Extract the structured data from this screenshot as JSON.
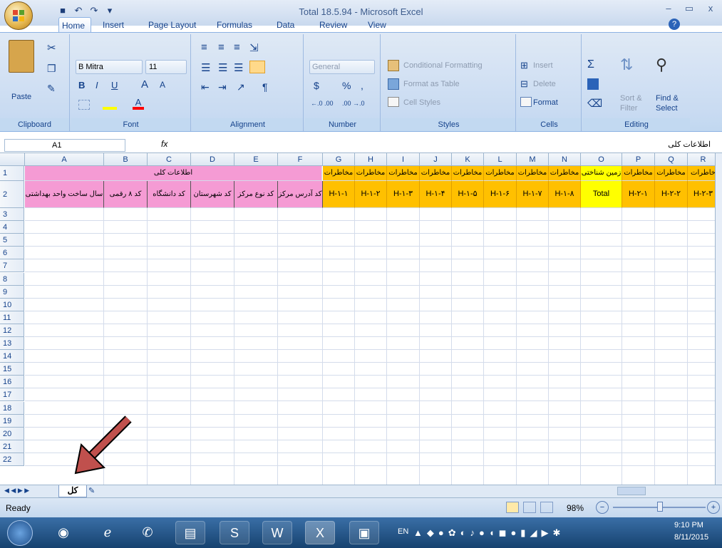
{
  "window": {
    "title": "Total 18.5.94 - Microsoft Excel",
    "min": "–",
    "restore": "▭",
    "close": "x"
  },
  "tabs": [
    {
      "label": "Home"
    },
    {
      "label": "Insert"
    },
    {
      "label": "Page Layout"
    },
    {
      "label": "Formulas"
    },
    {
      "label": "Data"
    },
    {
      "label": "Review"
    },
    {
      "label": "View"
    }
  ],
  "ribbon": {
    "clipboard": {
      "label": "Clipboard",
      "paste": "Paste"
    },
    "font": {
      "label": "Font",
      "name": "B Mitra",
      "size": "11",
      "bold": "B",
      "italic": "I",
      "underline": "U",
      "grow": "A",
      "shrink": "A"
    },
    "alignment": {
      "label": "Alignment"
    },
    "number": {
      "label": "Number",
      "format": "General",
      "currency": "$",
      "percent": "%",
      "comma": ",",
      "inc": "←.0 .00",
      "dec": ".00 →.0"
    },
    "styles": {
      "label": "Styles",
      "conditional": "Conditional Formatting",
      "table": "Format as Table",
      "cell": "Cell Styles"
    },
    "cells": {
      "label": "Cells",
      "insert": "Insert",
      "delete": "Delete",
      "format": "Format"
    },
    "editing": {
      "label": "Editing",
      "sigma": "Σ",
      "sort": "Sort &",
      "filter": "Filter",
      "find": "Find &",
      "select": "Select"
    }
  },
  "formula": {
    "namebox": "A1",
    "fx": "fx",
    "value": "اطلاعات کلی"
  },
  "grid": {
    "columns": [
      "A",
      "B",
      "C",
      "D",
      "E",
      "F",
      "G",
      "H",
      "I",
      "J",
      "K",
      "L",
      "M",
      "N",
      "O",
      "P",
      "Q",
      "R"
    ],
    "rows": [
      "1",
      "2",
      "3",
      "4",
      "5",
      "6",
      "7",
      "8",
      "9",
      "10",
      "11",
      "12",
      "13",
      "14",
      "15",
      "16",
      "17",
      "18",
      "19",
      "20",
      "21",
      "22"
    ],
    "merged_a1": "اطلاعات کلی",
    "row1_g_to_n": "مخاطرات",
    "row1_o": "زمین شناختی",
    "row1_p_q": "مخاطرات",
    "row1_r": "خاطرات",
    "row2": {
      "A": "سال ساخت واحد بهداشتی",
      "B": "کد ۸ رقمی",
      "C": "کد دانشگاه",
      "D": "کد شهرستان",
      "E": "کد نوع مرکز",
      "F": "کد آدرس مرکز",
      "G": "H-۱-۱",
      "H": "H-۱-۲",
      "I": "H-۱-۳",
      "J": "H-۱-۴",
      "K": "H-۱-۵",
      "L": "H-۱-۶",
      "M": "H-۱-۷",
      "N": "H-۱-۸",
      "O": "Total",
      "P": "H-۲-۱",
      "Q": "H-۲-۲",
      "R": "H-۲-۳"
    }
  },
  "sheets": {
    "active": "کل",
    "nav": "◀ ◀ ▶ ▶"
  },
  "status": {
    "ready": "Ready",
    "zoom": "98%"
  },
  "taskbar": {
    "lang": "EN",
    "time": "9:10 PM",
    "date": "8/11/2015"
  },
  "colors": {
    "pink": "#f59bd4",
    "orange": "#ffc000",
    "yellow": "#ffff00",
    "arrow": "#c0504d"
  }
}
